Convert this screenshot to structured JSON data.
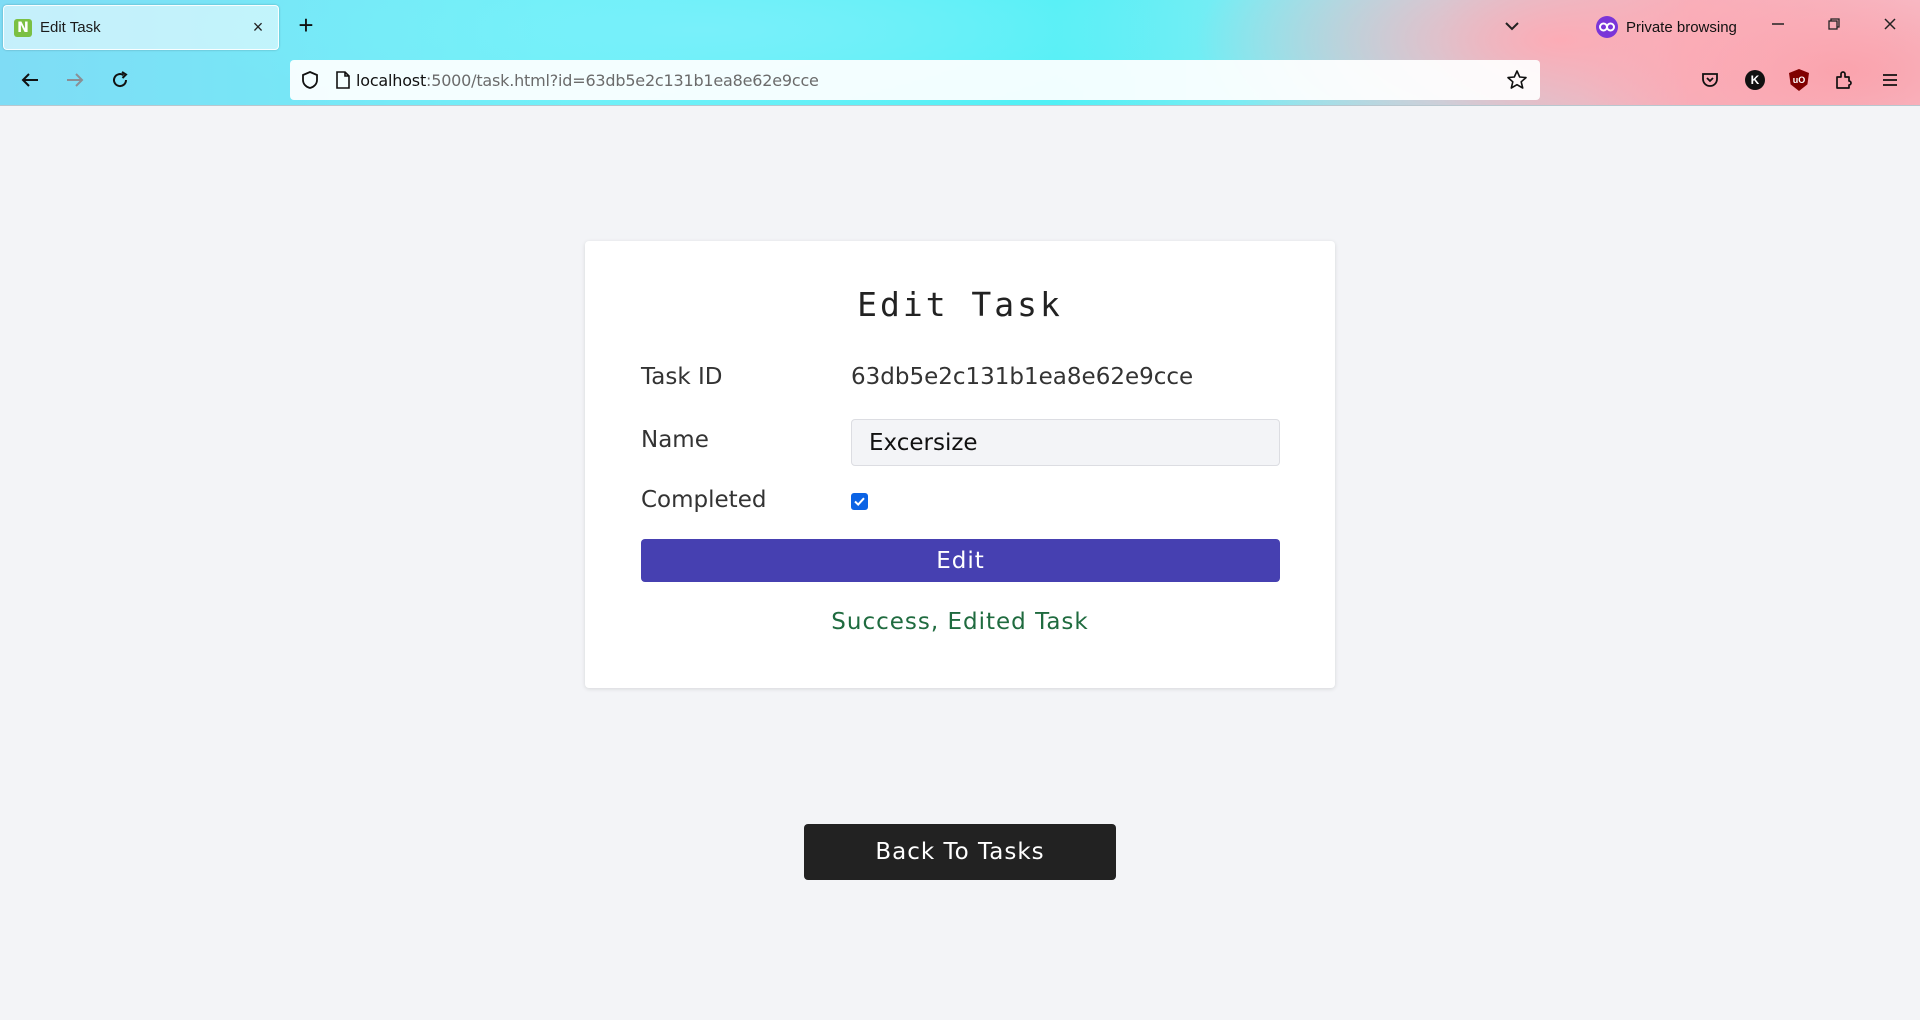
{
  "browser": {
    "tab_title": "Edit Task",
    "tab_favicon_letter": "N",
    "tab_close": "×",
    "new_tab": "+",
    "private_label": "Private browsing",
    "url_host": "localhost",
    "url_rest": ":5000/task.html?id=63db5e2c131b1ea8e62e9cce",
    "window_controls": [
      "minimize-icon",
      "restore-icon",
      "close-icon"
    ],
    "toolbar_icons": [
      "pocket-icon",
      "k-extension-icon",
      "ublock-icon",
      "extensions-icon",
      "menu-icon"
    ],
    "extension_k_letter": "K",
    "ublock_label": "uO"
  },
  "card": {
    "title": "Edit Task",
    "task_id_label": "Task ID",
    "task_id_value": "63db5e2c131b1ea8e62e9cce",
    "name_label": "Name",
    "name_value": "Excersize",
    "completed_label": "Completed",
    "completed_checked": true,
    "edit_button": "Edit",
    "success_message": "Success, Edited Task"
  },
  "back_button": "Back To Tasks",
  "colors": {
    "edit_button": "#4640b1",
    "back_button": "#222222",
    "success_text": "#1f6b3f",
    "page_background": "#f3f4f7",
    "checkbox": "#0b63e5"
  }
}
